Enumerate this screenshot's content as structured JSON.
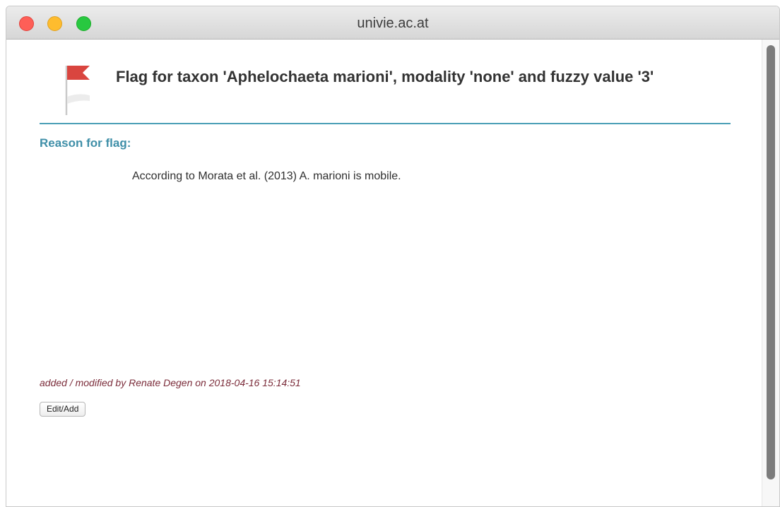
{
  "window": {
    "title": "univie.ac.at"
  },
  "page": {
    "heading": "Flag for taxon 'Aphelochaeta marioni', modality 'none' and fuzzy value '3'",
    "flag_icon": "red-flag-icon",
    "reason_label": "Reason for flag:",
    "reason_text": "According to Morata et al. (2013) A. marioni is mobile.",
    "modified_text": "added / modified by Renate Degen on 2018-04-16 15:14:51",
    "edit_button_label": "Edit/Add"
  },
  "colors": {
    "accent": "#4b9fb6",
    "flag": "#d9453f",
    "modified_text": "#7b2c3a"
  }
}
